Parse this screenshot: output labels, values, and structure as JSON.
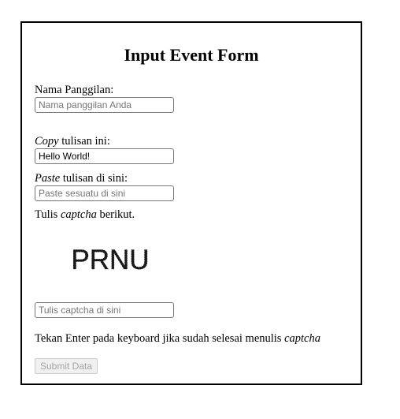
{
  "form": {
    "title": "Input Event Form",
    "nickname": {
      "label": "Nama Panggilan:",
      "placeholder": "Nama panggilan Anda",
      "value": ""
    },
    "copy": {
      "label_em": "Copy",
      "label_rest": " tulisan ini:",
      "value": "Hello World!"
    },
    "paste": {
      "label_em": "Paste",
      "label_rest": " tulisan di sini:",
      "placeholder": "Paste sesuatu di sini",
      "value": ""
    },
    "captcha": {
      "label_before": "Tulis ",
      "label_em": "captcha",
      "label_after": " berikut.",
      "image_text": "PRNU",
      "placeholder": "Tulis captcha di sini",
      "value": ""
    },
    "hint": {
      "text": "Tekan Enter pada keyboard jika sudah selesai menulis ",
      "em": "captcha"
    },
    "submit_label": "Submit Data"
  }
}
